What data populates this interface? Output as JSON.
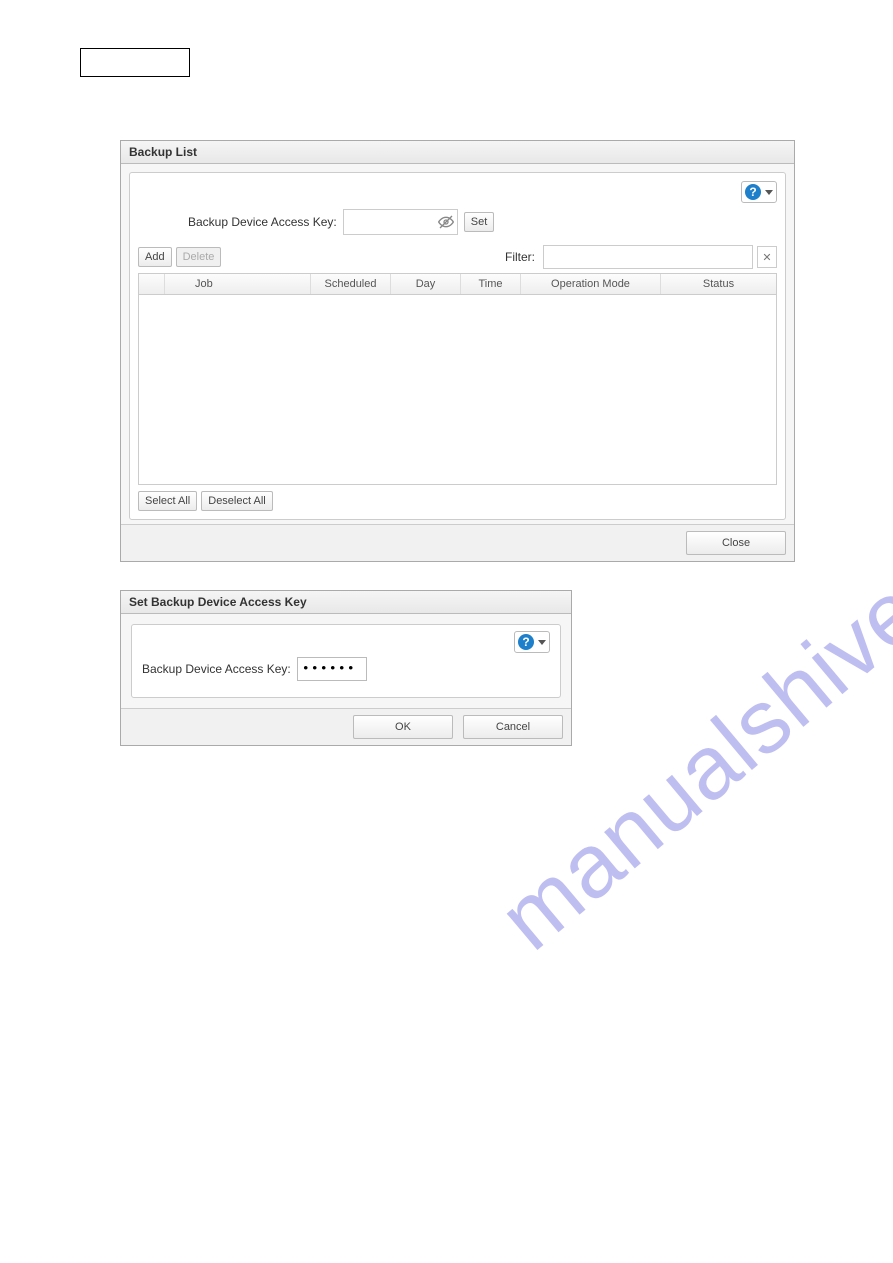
{
  "panel1": {
    "title": "Backup List",
    "access_key_label": "Backup Device Access Key:",
    "access_key_value": "",
    "set_btn": "Set",
    "add_btn": "Add",
    "delete_btn": "Delete",
    "filter_label": "Filter:",
    "filter_value": "",
    "clear_btn": "✕",
    "columns": {
      "job": "Job",
      "scheduled": "Scheduled",
      "day": "Day",
      "time": "Time",
      "opmode": "Operation Mode",
      "status": "Status"
    },
    "select_all": "Select All",
    "deselect_all": "Deselect All",
    "close_btn": "Close"
  },
  "panel2": {
    "title": "Set Backup Device Access Key",
    "access_key_label": "Backup Device Access Key:",
    "access_key_value": "••••••",
    "ok_btn": "OK",
    "cancel_btn": "Cancel"
  },
  "watermark": "manualshive.com"
}
